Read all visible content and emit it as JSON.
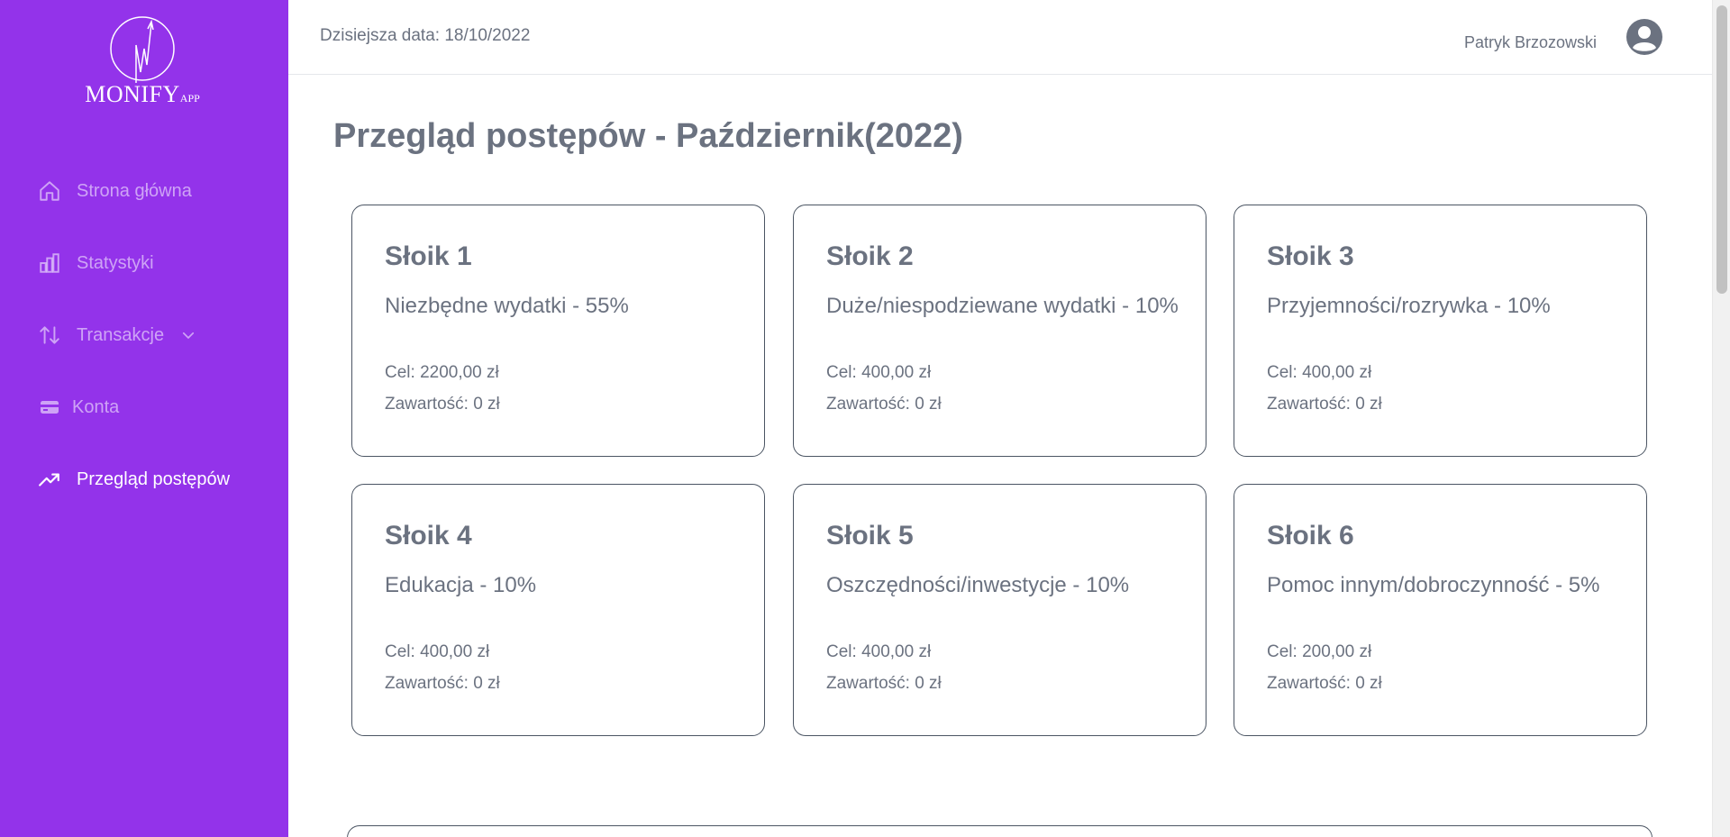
{
  "app": {
    "logo_text": "MONIFY",
    "logo_sub": "APP"
  },
  "sidebar": {
    "items": [
      {
        "label": "Strona główna",
        "icon": "home-icon"
      },
      {
        "label": "Statystyki",
        "icon": "bar-chart-icon"
      },
      {
        "label": "Transakcje",
        "icon": "arrows-up-down-icon"
      },
      {
        "label": "Konta",
        "icon": "credit-card-icon"
      },
      {
        "label": "Przegląd postępów",
        "icon": "trending-up-icon"
      }
    ],
    "active_index": 4
  },
  "header": {
    "date_text": "Dzisiejsza data: 18/10/2022",
    "user_name": "Patryk Brzozowski"
  },
  "main": {
    "title": "Przegląd postępów - Październik(2022)",
    "jars": [
      {
        "title": "Słoik 1",
        "desc": "Niezbędne wydatki - 55%",
        "goal": "Cel: 2200,00 zł",
        "content": "Zawartość: 0 zł"
      },
      {
        "title": "Słoik 2",
        "desc": "Duże/niespodziewane wydatki - 10%",
        "goal": "Cel: 400,00 zł",
        "content": "Zawartość: 0 zł"
      },
      {
        "title": "Słoik 3",
        "desc": "Przyjemności/rozrywka - 10%",
        "goal": "Cel: 400,00 zł",
        "content": "Zawartość: 0 zł"
      },
      {
        "title": "Słoik 4",
        "desc": "Edukacja - 10%",
        "goal": "Cel: 400,00 zł",
        "content": "Zawartość: 0 zł"
      },
      {
        "title": "Słoik 5",
        "desc": "Oszczędności/inwestycje - 10%",
        "goal": "Cel: 400,00 zł",
        "content": "Zawartość: 0 zł"
      },
      {
        "title": "Słoik 6",
        "desc": "Pomoc innym/dobroczynność - 5%",
        "goal": "Cel: 200,00 zł",
        "content": "Zawartość: 0 zł"
      }
    ]
  },
  "colors": {
    "sidebar_bg": "#9333ea",
    "text": "#6b7280",
    "card_border": "#4b5563"
  }
}
